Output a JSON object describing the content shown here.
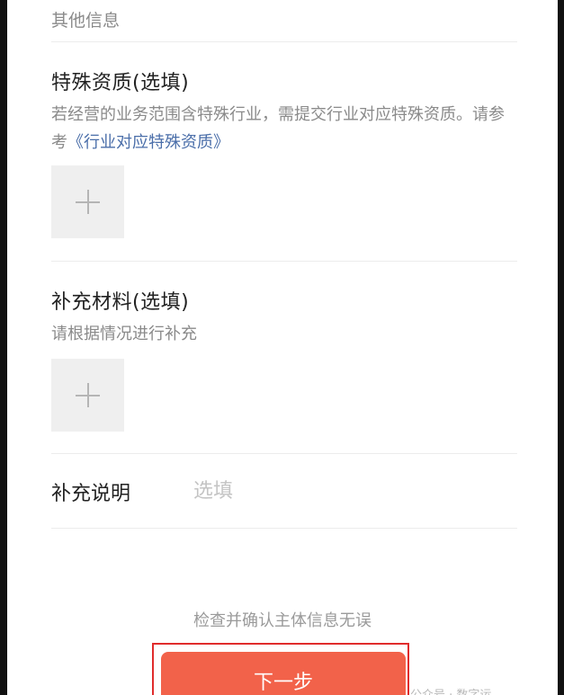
{
  "other_info": {
    "title": "其他信息"
  },
  "special_qualification": {
    "title": "特殊资质(选填)",
    "desc_prefix": "若经营的业务范围含特殊行业，需提交行业对应特殊资质。请参考",
    "desc_link": "《行业对应特殊资质》",
    "upload_icon": "plus-icon"
  },
  "supplementary_materials": {
    "title": "补充材料(选填)",
    "desc": "请根据情况进行补充",
    "upload_icon": "plus-icon"
  },
  "supplementary_note": {
    "label": "补充说明",
    "placeholder": "选填",
    "value": ""
  },
  "footer": {
    "confirm_text": "检查并确认主体信息无误",
    "next_button_label": "下一步",
    "watermark": "公众号 · 数字运"
  },
  "colors": {
    "primary_button": "#f2624a",
    "link": "#4a6ea9",
    "highlight_border": "#e02c2c"
  }
}
